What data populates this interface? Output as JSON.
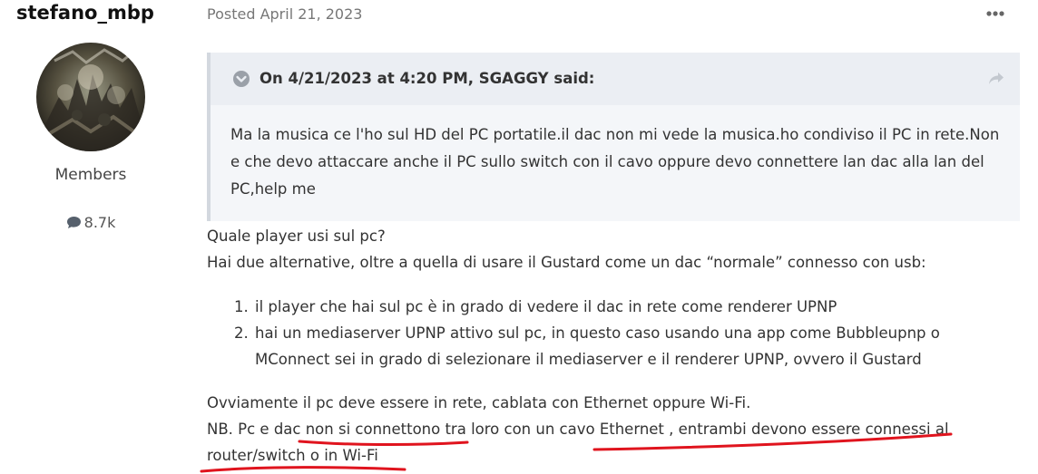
{
  "author": {
    "username": "stefano_mbp",
    "group": "Members",
    "post_count": "8.7k",
    "post_count_icon": "comment-icon"
  },
  "post": {
    "posted_label": "Posted April 21, 2023",
    "menu_icon": "ellipsis-icon",
    "quote": {
      "toggle_icon": "chevron-down-circle-icon",
      "citation": "On 4/21/2023 at 4:20 PM, SGAGGY said:",
      "share_icon": "share-icon",
      "body": "Ma la musica ce l'ho sul HD del PC portatile.il dac non mi vede la musica.ho condiviso il PC in rete.Non e che devo attaccare anche il PC sullo switch con il cavo oppure devo connettere lan dac alla lan del PC,help me"
    },
    "lines": [
      "Quale player usi sul pc?",
      "Hai due alternative, oltre a quella di usare il Gustard come un dac “normale” connesso con usb:"
    ],
    "list": [
      {
        "num": "1.",
        "text": "il player che hai sul pc è in grado di vedere il dac in rete come renderer UPNP"
      },
      {
        "num": "2.",
        "text": "hai un mediaserver UPNP attivo sul pc, in questo caso usando una app come Bubbleupnp o MConnect sei in grado di selezionare il mediaserver e il renderer UPNP, ovvero il Gustard"
      }
    ],
    "closing": [
      "Ovviamente il pc deve essere in rete, cablata con Ethernet oppure Wi-Fi.",
      "NB. Pc e dac non si connettono tra loro con un cavo Ethernet , entrambi devono essere connessi al",
      "router/switch o in Wi-Fi"
    ]
  },
  "colors": {
    "annotation_red": "#e0141e",
    "quote_bg": "#f4f6f9",
    "quote_header_bg": "#ebeef3",
    "quote_border": "#d3d8df"
  }
}
